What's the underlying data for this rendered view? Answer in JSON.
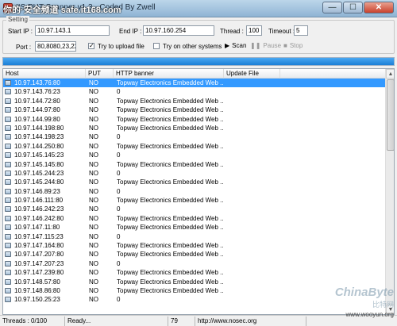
{
  "window": {
    "title": "IIS PUT Scanner v1.3 - Coded By Zwell",
    "watermark": "你的·安全频道 safe.it168.com",
    "min_glyph": "—",
    "max_glyph": "☐",
    "close_glyph": "✕"
  },
  "settings": {
    "legend": "Setting",
    "start_ip_label": "Start IP :",
    "start_ip_value": "10.97.143.1",
    "end_ip_label": "End IP :",
    "end_ip_value": "10.97.160.254",
    "thread_label": "Thread :",
    "thread_value": "100",
    "timeout_label": "Timeout :",
    "timeout_value": "5",
    "port_label": "Port :",
    "port_value": "80,8080,23,22",
    "upload_label": "Try to upload file",
    "upload_checked": true,
    "other_systems_label": "Try on other systems",
    "other_systems_checked": false,
    "scan_label": "Scan",
    "pause_label": "Pause",
    "stop_label": "Stop"
  },
  "progress": {
    "fraction": 1.0
  },
  "table": {
    "headers": [
      "Host",
      "PUT",
      "HTTP banner",
      "Update File"
    ],
    "rows": [
      {
        "host": "10.97.143.76:80",
        "put": "NO",
        "banner": "Topway Electronics Embedded Web ...",
        "file": "",
        "selected": true
      },
      {
        "host": "10.97.143.76:23",
        "put": "NO",
        "banner": "0",
        "file": ""
      },
      {
        "host": "10.97.144.72:80",
        "put": "NO",
        "banner": "Topway Electronics Embedded Web ...",
        "file": ""
      },
      {
        "host": "10.97.144.97:80",
        "put": "NO",
        "banner": "Topway Electronics Embedded Web ...",
        "file": ""
      },
      {
        "host": "10.97.144.99:80",
        "put": "NO",
        "banner": "Topway Electronics Embedded Web ...",
        "file": ""
      },
      {
        "host": "10.97.144.198:80",
        "put": "NO",
        "banner": "Topway Electronics Embedded Web ...",
        "file": ""
      },
      {
        "host": "10.97.144.198:23",
        "put": "NO",
        "banner": "0",
        "file": ""
      },
      {
        "host": "10.97.144.250:80",
        "put": "NO",
        "banner": "Topway Electronics Embedded Web ...",
        "file": ""
      },
      {
        "host": "10.97.145.145:23",
        "put": "NO",
        "banner": "0",
        "file": ""
      },
      {
        "host": "10.97.145.145:80",
        "put": "NO",
        "banner": "Topway Electronics Embedded Web ...",
        "file": ""
      },
      {
        "host": "10.97.145.244:23",
        "put": "NO",
        "banner": "0",
        "file": ""
      },
      {
        "host": "10.97.145.244:80",
        "put": "NO",
        "banner": "Topway Electronics Embedded Web ...",
        "file": ""
      },
      {
        "host": "10.97.146.89:23",
        "put": "NO",
        "banner": "0",
        "file": ""
      },
      {
        "host": "10.97.146.111:80",
        "put": "NO",
        "banner": "Topway Electronics Embedded Web ...",
        "file": ""
      },
      {
        "host": "10.97.146.242:23",
        "put": "NO",
        "banner": "0",
        "file": ""
      },
      {
        "host": "10.97.146.242:80",
        "put": "NO",
        "banner": "Topway Electronics Embedded Web ...",
        "file": ""
      },
      {
        "host": "10.97.147.11:80",
        "put": "NO",
        "banner": "Topway Electronics Embedded Web ...",
        "file": ""
      },
      {
        "host": "10.97.147.115:23",
        "put": "NO",
        "banner": "0",
        "file": ""
      },
      {
        "host": "10.97.147.164:80",
        "put": "NO",
        "banner": "Topway Electronics Embedded Web ...",
        "file": ""
      },
      {
        "host": "10.97.147.207:80",
        "put": "NO",
        "banner": "Topway Electronics Embedded Web ...",
        "file": ""
      },
      {
        "host": "10.97.147.207:23",
        "put": "NO",
        "banner": "0",
        "file": ""
      },
      {
        "host": "10.97.147.239:80",
        "put": "NO",
        "banner": "Topway Electronics Embedded Web ...",
        "file": ""
      },
      {
        "host": "10.97.148.57:80",
        "put": "NO",
        "banner": "Topway Electronics Embedded Web ...",
        "file": ""
      },
      {
        "host": "10.97.148.86:80",
        "put": "NO",
        "banner": "Topway Electronics Embedded Web ...",
        "file": ""
      },
      {
        "host": "10.97.150.25:23",
        "put": "NO",
        "banner": "0",
        "file": ""
      }
    ]
  },
  "status": {
    "threads": "Threads : 0/100",
    "state": "Ready...",
    "count": "79",
    "url": "http://www.nosec.org"
  },
  "corner": {
    "brand": "ChinaByte",
    "brand_cn": "比特网",
    "site": "www.wooyun.org"
  },
  "colors": {
    "selection": "#3399ff",
    "progress": "#1b7fd6"
  }
}
